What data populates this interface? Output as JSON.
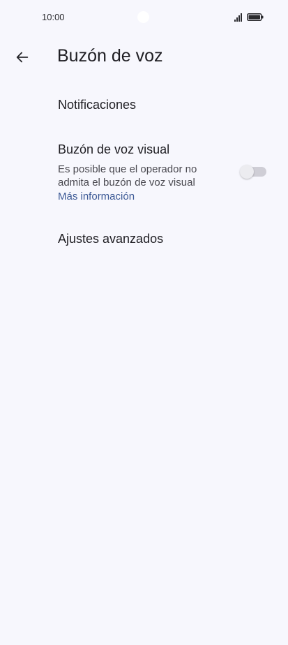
{
  "status_bar": {
    "time": "10:00"
  },
  "header": {
    "title": "Buzón de voz"
  },
  "settings": {
    "notifications": {
      "label": "Notificaciones"
    },
    "visual_voicemail": {
      "label": "Buzón de voz visual",
      "subtitle": "Es posible que el operador no admita el buzón de voz visual",
      "link": "Más información",
      "enabled": false
    },
    "advanced": {
      "label": "Ajustes avanzados"
    }
  },
  "colors": {
    "background": "#f7f7fd",
    "link": "#3d5a96",
    "toggle_off": "#cfced6"
  }
}
